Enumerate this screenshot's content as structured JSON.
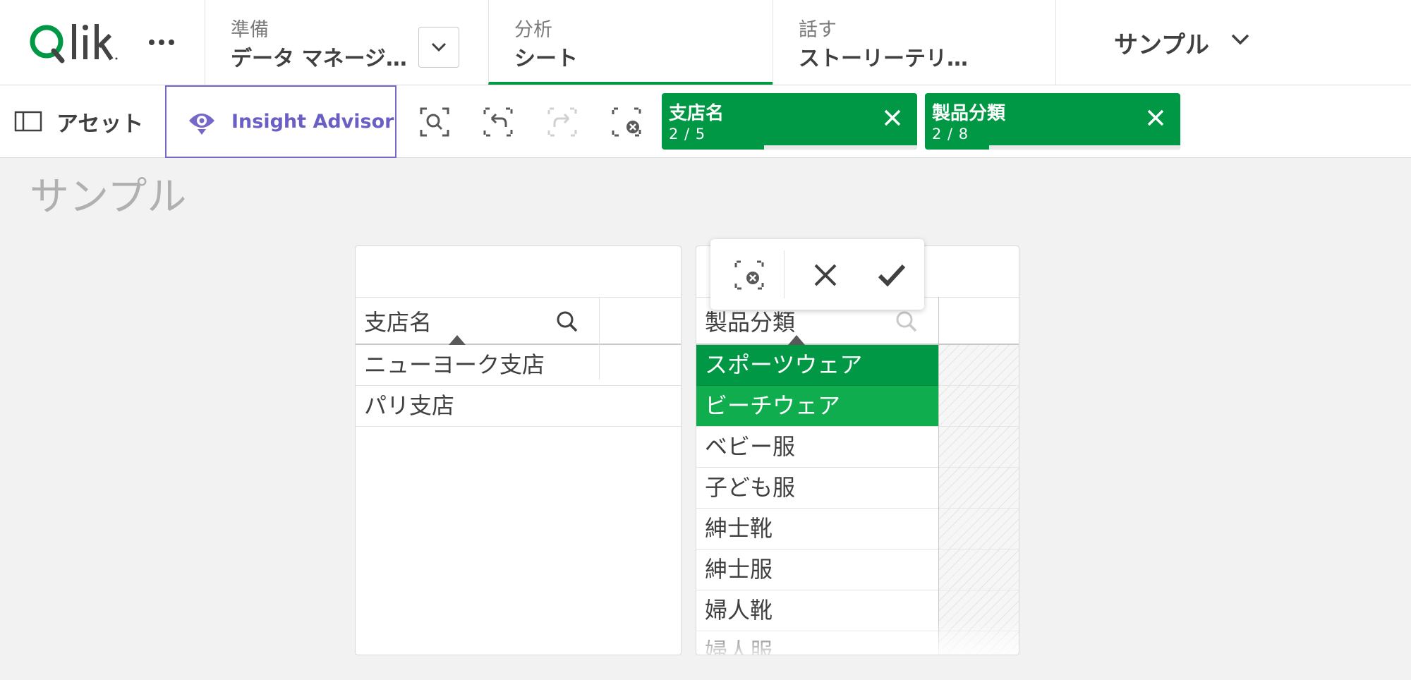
{
  "brand": {
    "logo_text": "Qlik"
  },
  "nav": {
    "prepare": {
      "label": "準備",
      "value": "データ マネージ…"
    },
    "analyze": {
      "label": "分析",
      "value": "シート"
    },
    "narrate": {
      "label": "話す",
      "value": "ストーリーテリ…"
    },
    "app_title": "サンプル"
  },
  "toolbar": {
    "assets_label": "アセット",
    "insight_label": "Insight Advisor",
    "selections": [
      {
        "name": "支店名",
        "count": "2 / 5",
        "fraction": 0.4
      },
      {
        "name": "製品分類",
        "count": "2 / 8",
        "fraction": 0.25
      }
    ]
  },
  "sheet": {
    "title": "サンプル"
  },
  "listbox_branch": {
    "title": "支店名",
    "rows": [
      "ニューヨーク支店",
      "パリ支店"
    ]
  },
  "listbox_category": {
    "title": "製品分類",
    "rows": [
      "スポーツウェア",
      "ビーチウェア",
      "ベビー服",
      "子ども服",
      "紳士靴",
      "紳士服",
      "婦人靴",
      "婦人服"
    ],
    "selected_count": 2
  },
  "colors": {
    "selected": "#009845",
    "accent": "#6a5fc4"
  }
}
